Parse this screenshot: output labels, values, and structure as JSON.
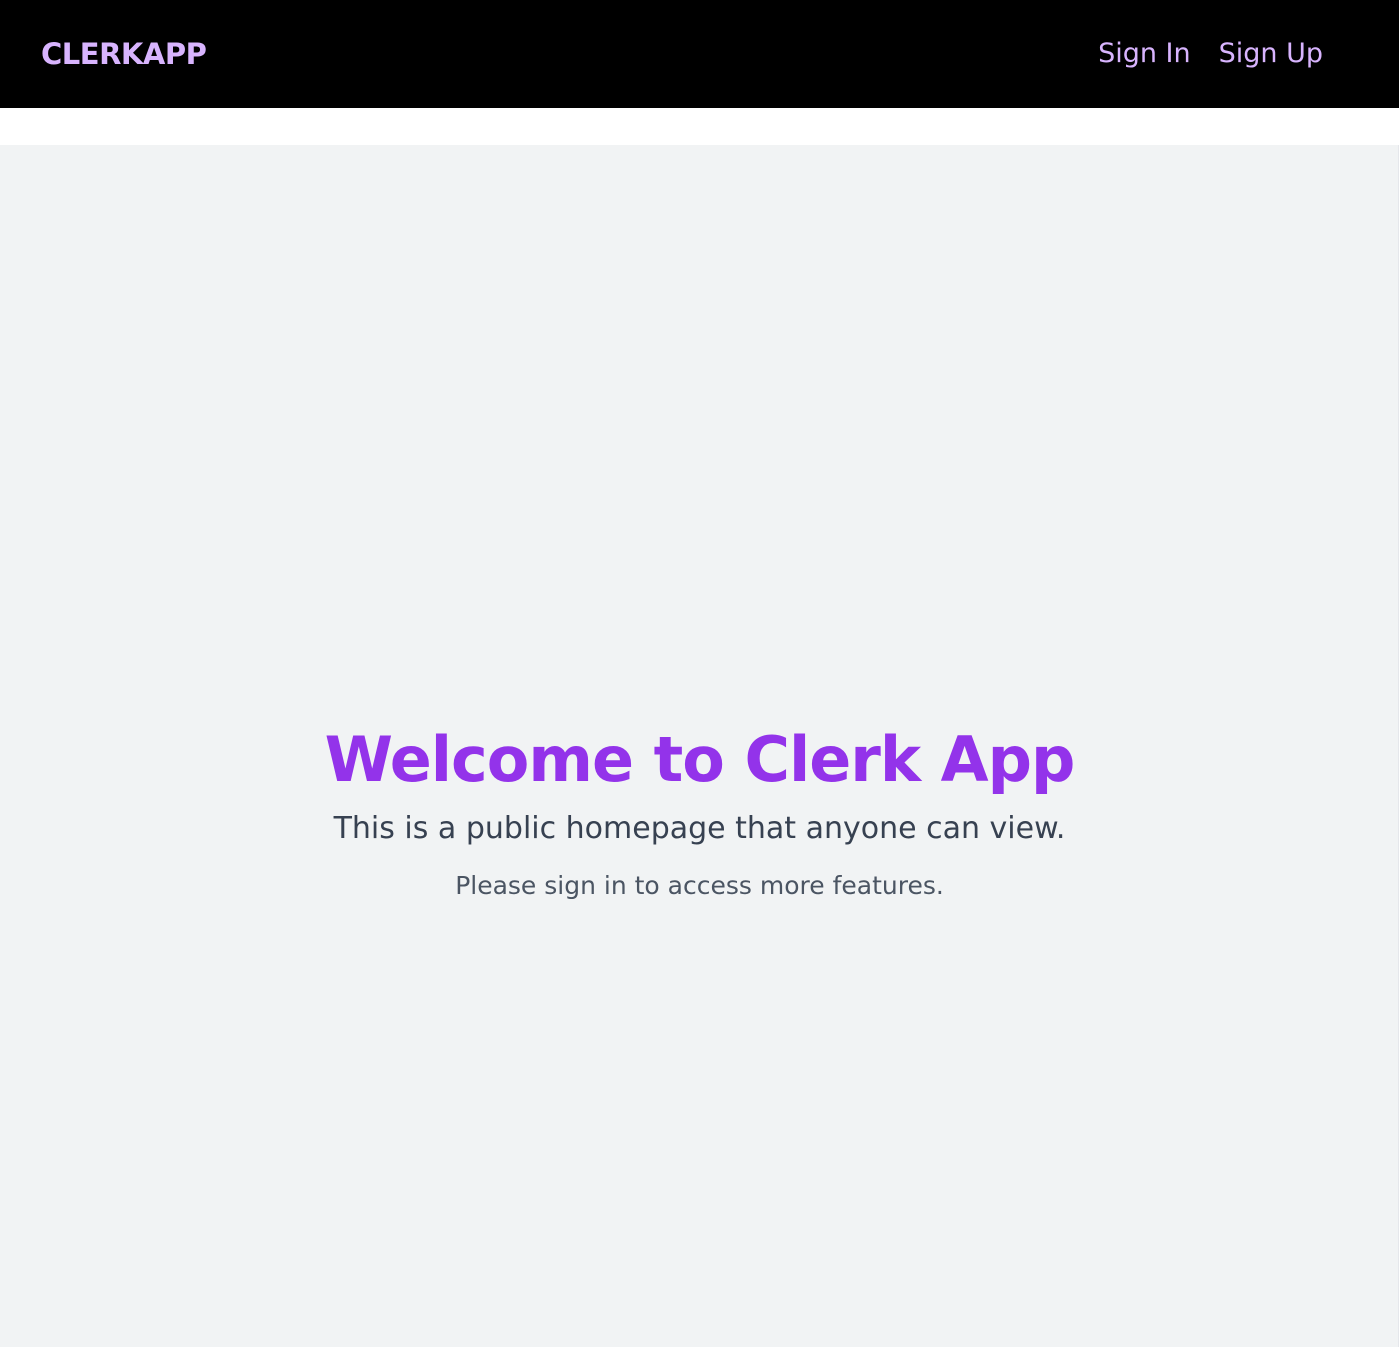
{
  "navbar": {
    "brand": "CLERKAPP",
    "links": [
      {
        "label": "Sign In"
      },
      {
        "label": "Sign Up"
      }
    ]
  },
  "hero": {
    "title": "Welcome to Clerk App",
    "subtitle": "This is a public homepage that anyone can view.",
    "note": "Please sign in to access more features."
  },
  "colors": {
    "navbar_bg": "#000000",
    "accent_light": "#d8b4fe",
    "accent": "#9333ea",
    "page_bg": "#f1f3f4",
    "text_primary": "#374151",
    "text_secondary": "#4b5563"
  }
}
